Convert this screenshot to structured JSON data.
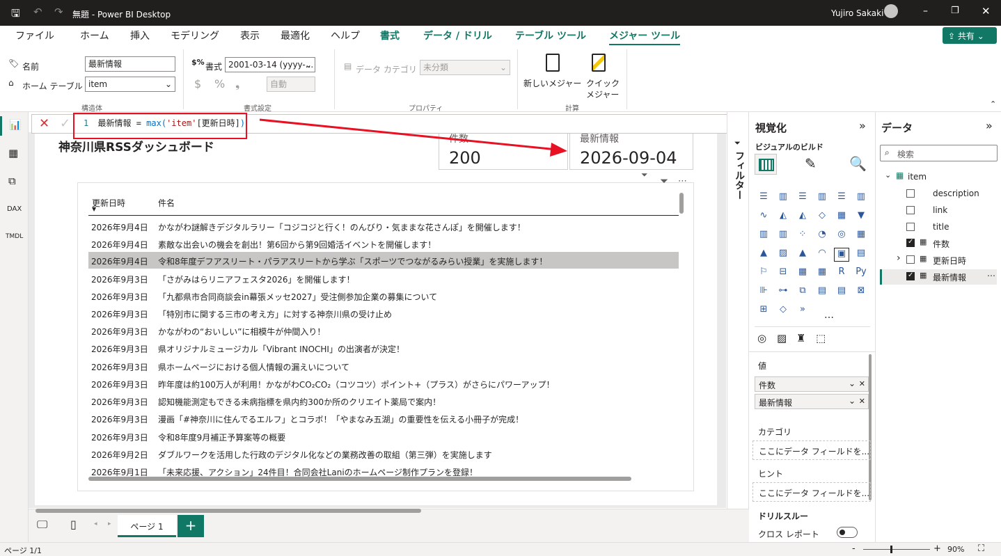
{
  "window": {
    "title": "無題 - Power BI Desktop",
    "user": "Yujiro Sakaki"
  },
  "menu_tabs": [
    {
      "label": "ファイル"
    },
    {
      "label": "ホーム"
    },
    {
      "label": "挿入"
    },
    {
      "label": "モデリング"
    },
    {
      "label": "表示"
    },
    {
      "label": "最適化"
    },
    {
      "label": "ヘルプ"
    },
    {
      "label": "書式"
    },
    {
      "label": "データ / ドリル"
    },
    {
      "label": "テーブル ツール"
    },
    {
      "label": "メジャー ツール"
    }
  ],
  "share_label": "共有",
  "ribbon": {
    "name_label": "名前",
    "name_value": "最新情報",
    "home_table_label": "ホーム テーブル",
    "home_table_value": "item",
    "structure_group": "構造体",
    "format_label": "書式",
    "format_value": "2001-03-14 (yyyy-...",
    "format_group": "書式設定",
    "dollar_symbol": "$",
    "percent_symbol": "%",
    "comma_symbol": "❟",
    "auto_value": "自動",
    "data_category_label": "データ カテゴリ",
    "data_category_value": "未分類",
    "properties_group": "プロパティ",
    "new_measure_label": "新しいメジャー",
    "quick_measure_label1": "クイック",
    "quick_measure_label2": "メジャー",
    "calc_group": "計算"
  },
  "formula": {
    "line_no": "1",
    "measure": "最新情報",
    "eq": " = ",
    "func": "max(",
    "table": "'item'",
    "col": "[更新日時]",
    "close": ")"
  },
  "report": {
    "title": "神奈川県RSSダッシュボード",
    "card1": {
      "label": "件数",
      "value": "200"
    },
    "card2": {
      "label": "最新情報",
      "value": "2026-09-04"
    },
    "table_headers": {
      "date": "更新日時",
      "name": "件名"
    },
    "rows": [
      {
        "d": "2026年9月4日",
        "n": "かながわ謎解きデジタルラリー「コジコジと行く！のんびり・気ままな花さんぽ」を開催します！"
      },
      {
        "d": "2026年9月4日",
        "n": "素敵な出会いの機会を創出！第6回から第9回婚活イベントを開催します！"
      },
      {
        "d": "2026年9月4日",
        "n": "令和8年度デフアスリート・パラアスリートから学ぶ「スポーツでつながるみらい授業」を実施します！"
      },
      {
        "d": "2026年9月3日",
        "n": "「さがみはらリニアフェスタ2026」を開催します！"
      },
      {
        "d": "2026年9月3日",
        "n": "「九都県市合同商談会in幕張メッセ2027」受注側参加企業の募集について"
      },
      {
        "d": "2026年9月3日",
        "n": "「特別市に関する三市の考え方」に対する神奈川県の受け止め"
      },
      {
        "d": "2026年9月3日",
        "n": "かながわの“おいしい”に相模牛が仲間入り！"
      },
      {
        "d": "2026年9月3日",
        "n": "県オリジナルミュージカル「Vibrant INOCHI」の出演者が決定！"
      },
      {
        "d": "2026年9月3日",
        "n": "県ホームページにおける個人情報の漏えいについて"
      },
      {
        "d": "2026年9月3日",
        "n": "昨年度は約100万人が利用！かながわCO₂CO₂（コツコツ）ポイント+（プラス）がさらにパワーアップ！"
      },
      {
        "d": "2026年9月3日",
        "n": "認知機能測定もできる未病指標を県内約300か所のクリエイト薬局で案内！"
      },
      {
        "d": "2026年9月3日",
        "n": "漫画「#神奈川に住んでるエルフ」とコラボ！「やまなみ五湖」の重要性を伝える小冊子が完成！"
      },
      {
        "d": "2026年9月3日",
        "n": "令和8年度9月補正予算案等の概要"
      },
      {
        "d": "2026年9月2日",
        "n": "ダブルワークを活用した行政のデジタル化などの業務改善の取組（第三弾）を実施します"
      },
      {
        "d": "2026年9月1日",
        "n": "「未来応援、アクション」24件目！合同会社Laniのホームページ制作プランを登録！"
      }
    ]
  },
  "filters_label": "フィルター",
  "viz": {
    "title": "視覚化",
    "build": "ビジュアルのビルド",
    "values": "値",
    "well1": "件数",
    "well2": "最新情報",
    "category": "カテゴリ",
    "hint": "ヒント",
    "drop1": "ここにデータ フィールドを...",
    "drop2": "ここにデータ フィールドを...",
    "drill": "ドリルスルー",
    "cross": "クロス レポート",
    "more": "…"
  },
  "data_pane": {
    "title": "データ",
    "search_placeholder": "検索",
    "table": "item",
    "fields": [
      {
        "label": "description",
        "checked": false
      },
      {
        "label": "link",
        "checked": false
      },
      {
        "label": "title",
        "checked": false
      },
      {
        "label": "件数",
        "checked": true
      },
      {
        "label": "更新日時",
        "checked": false
      },
      {
        "label": "最新情報",
        "checked": true
      }
    ]
  },
  "page_tab": "ページ 1",
  "status": {
    "page": "ページ 1/1",
    "zoom": "90%"
  }
}
